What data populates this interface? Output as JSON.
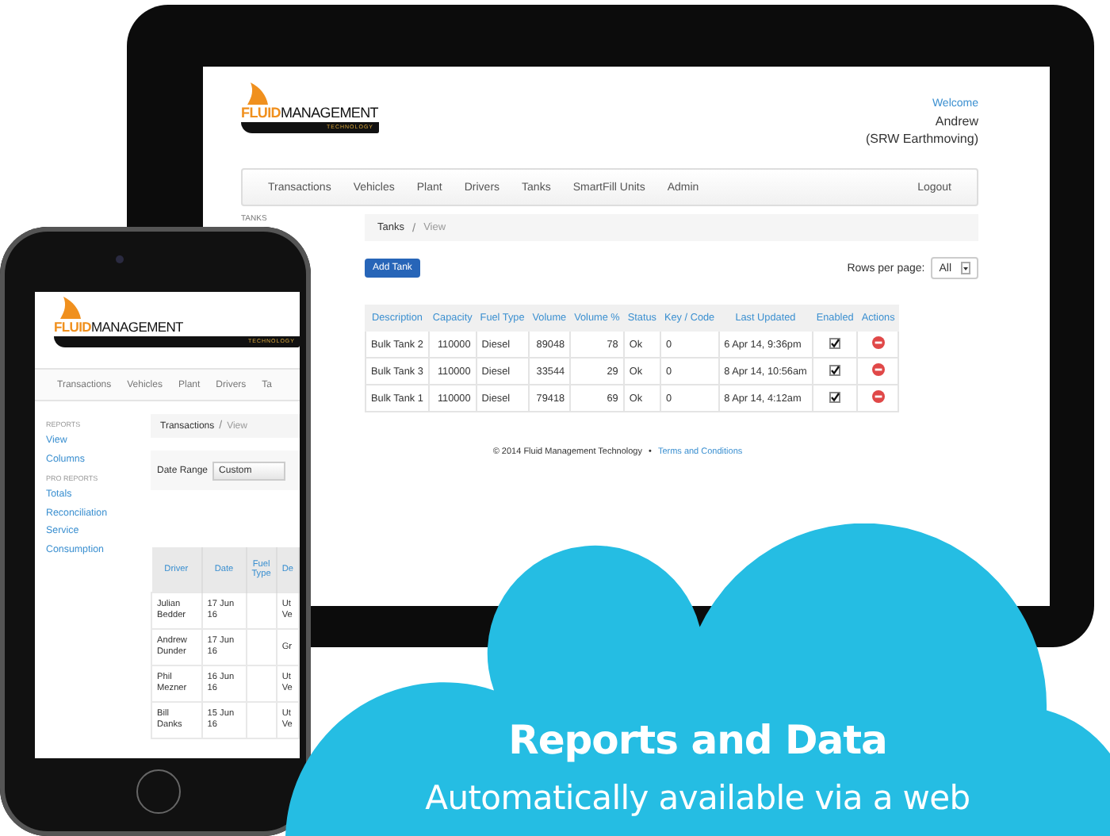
{
  "tablet": {
    "logo": {
      "word_1": "FLUID",
      "word_2": "MANAGEMENT",
      "tagline": "TECHNOLOGY"
    },
    "user": {
      "greeting": "Welcome",
      "name": "Andrew",
      "company": "(SRW Earthmoving)"
    },
    "nav": {
      "items": [
        "Transactions",
        "Vehicles",
        "Plant",
        "Drivers",
        "Tanks",
        "SmartFill Units",
        "Admin"
      ],
      "logout": "Logout"
    },
    "sidebar": {
      "heading": "TANKS"
    },
    "breadcrumb": {
      "items": [
        "Tanks",
        "View"
      ],
      "separator": "/"
    },
    "add_button": "Add Tank",
    "rows_per_page": {
      "label": "Rows per page:",
      "value": "All"
    },
    "table": {
      "columns": [
        "Description",
        "Capacity",
        "Fuel Type",
        "Volume",
        "Volume %",
        "Status",
        "Key / Code",
        "Last Updated",
        "Enabled",
        "Actions"
      ],
      "rows": [
        {
          "cells": [
            "Bulk Tank 2",
            "110000",
            "Diesel",
            "89048",
            "78",
            "Ok",
            "0",
            "6 Apr 14, 9:36pm"
          ],
          "enabled": true
        },
        {
          "cells": [
            "Bulk Tank 3",
            "110000",
            "Diesel",
            "33544",
            "29",
            "Ok",
            "0",
            "8 Apr 14, 10:56am"
          ],
          "enabled": true
        },
        {
          "cells": [
            "Bulk Tank 1",
            "110000",
            "Diesel",
            "79418",
            "69",
            "Ok",
            "0",
            "8 Apr 14, 4:12am"
          ],
          "enabled": true
        }
      ]
    },
    "footer": {
      "copyright": "© 2014 Fluid Management Technology",
      "bullet": "•",
      "link": "Terms and Conditions"
    }
  },
  "phone": {
    "logo": {
      "word_1": "FLUID",
      "word_2": "MANAGEMENT",
      "tagline": "TECHNOLOGY"
    },
    "nav": {
      "items": [
        "Transactions",
        "Vehicles",
        "Plant",
        "Drivers",
        "Ta"
      ]
    },
    "sidebar": {
      "sections": [
        {
          "heading": "REPORTS",
          "links": [
            "View",
            "Columns"
          ]
        },
        {
          "heading": "PRO REPORTS",
          "links": [
            "Totals",
            "Reconciliation",
            "Service",
            "Consumption"
          ]
        }
      ]
    },
    "breadcrumb": {
      "items": [
        "Transactions",
        "View"
      ],
      "separator": "/"
    },
    "date_range": {
      "label": "Date Range",
      "value": "Custom"
    },
    "table": {
      "columns": [
        "Driver",
        "Date",
        "Fuel Type",
        "De"
      ],
      "rows": [
        {
          "cells": [
            "Julian Bedder",
            "17 Jun 16",
            "",
            "Ut Ve"
          ]
        },
        {
          "cells": [
            "Andrew Dunder",
            "17 Jun 16",
            "",
            "Gr"
          ]
        },
        {
          "cells": [
            "Phil Mezner",
            "16 Jun 16",
            "",
            "Ut Ve"
          ]
        },
        {
          "cells": [
            "Bill Danks",
            "15 Jun 16",
            "",
            "Ut Ve"
          ]
        }
      ]
    }
  },
  "cloud": {
    "title": "Reports and Data",
    "subtitle": "Automatically available via a web"
  }
}
